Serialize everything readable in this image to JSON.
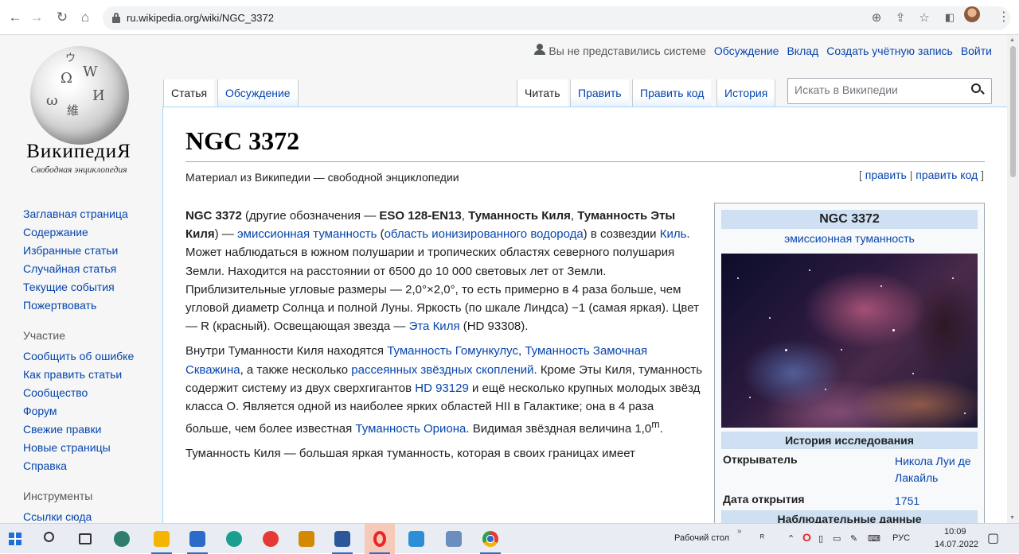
{
  "browser": {
    "url": "ru.wikipedia.org/wiki/NGC_3372",
    "icons": [
      "back-icon",
      "forward-icon",
      "reload-icon",
      "home-icon",
      "zoom-icon",
      "share-icon",
      "star-icon",
      "sidepanel-icon",
      "profile-icon",
      "menu-icon"
    ]
  },
  "logo": {
    "wordmark": "ВикипедиЯ",
    "tagline": "Свободная энциклопедия"
  },
  "sidebar": {
    "nav": [
      "Заглавная страница",
      "Содержание",
      "Избранные статьи",
      "Случайная статья",
      "Текущие события",
      "Пожертвовать"
    ],
    "participation_title": "Участие",
    "participation": [
      "Сообщить об ошибке",
      "Как править статьи",
      "Сообщество",
      "Форум",
      "Свежие правки",
      "Новые страницы",
      "Справка"
    ],
    "tools_title": "Инструменты",
    "tools": [
      "Ссылки сюда"
    ]
  },
  "personal": {
    "anon": "Вы не представились системе",
    "links": [
      "Обсуждение",
      "Вклад",
      "Создать учётную запись",
      "Войти"
    ]
  },
  "tabs": {
    "left": [
      "Статья",
      "Обсуждение"
    ],
    "right": [
      "Читать",
      "Править",
      "Править код",
      "История"
    ]
  },
  "search": {
    "placeholder": "Искать в Википедии"
  },
  "article": {
    "title": "NGC 3372",
    "tagline": "Материал из Википедии — свободной энциклопедии",
    "edit_open": "[ ",
    "edit": "править",
    "edit_sep": " | ",
    "edit_code": "править код",
    "edit_close": " ]",
    "p1": {
      "a": "NGC 3372",
      "b": " (другие обозначения — ",
      "c": "ESO 128-EN13",
      "d": ", ",
      "e": "Туманность Киля",
      "f": ", ",
      "g": "Туманность Эты Киля",
      "h": ") — ",
      "i": "эмиссионная туманность",
      "j": " (",
      "k": "область ионизированного водорода",
      "l": ") в созвездии ",
      "m": "Киль",
      "n": ". Может наблюдаться в южном полушарии и тропических областях северного полушария Земли. Находится на расстоянии от 6500 до 10 000 световых лет от Земли. Приблизительные угловые размеры — 2,0°×2,0°, то есть примерно в 4 раза больше, чем угловой диаметр Солнца и полной Луны. Яркость (по шкале Линдса) −1 (самая яркая). Цвет — R (красный). Освещающая звезда — ",
      "o": "Эта Киля",
      "p": " (HD 93308)."
    },
    "p2": {
      "a": "Внутри Туманности Киля находятся ",
      "b": "Туманность Гомункулус",
      "c": ", ",
      "d": "Туманность Замочная Скважина",
      "e": ", а также несколько ",
      "f": "рассеянных звёздных скоплений",
      "g": ". Кроме Эты Киля, туманность содержит систему из двух сверхгигантов ",
      "h": "HD 93129",
      "i": " и ещё несколько крупных молодых звёзд класса O. Является одной из наиболее ярких областей HII в Галактике; она в 4 раза больше, чем более известная ",
      "j": "Туманность Ориона",
      "k": ". Видимая звёздная величина 1,0",
      "l": "m",
      "m": "."
    },
    "p3": "Туманность Киля — большая яркая туманность, которая в своих границах имеет"
  },
  "infobox": {
    "title": "NGC 3372",
    "subtitle": "эмиссионная туманность",
    "section1": "История исследования",
    "rows": [
      {
        "key": "Открыватель",
        "value": "Никола Луи де Лакайль"
      },
      {
        "key": "Дата открытия",
        "value": "1751"
      }
    ],
    "section2": "Наблюдательные данные"
  },
  "taskbar": {
    "desktop_label": "Рабочий стол",
    "lang": "РУС",
    "time": "10:09",
    "date": "14.07.2022",
    "apps": [
      {
        "name": "windows-start-icon",
        "color": "#1e6fd9"
      },
      {
        "name": "search-icon",
        "color": "#333333"
      },
      {
        "name": "task-view-icon",
        "color": "#333333"
      },
      {
        "name": "app-circle-icon",
        "color": "#2e7d6e"
      },
      {
        "name": "file-explorer-icon",
        "color": "#f5b400"
      },
      {
        "name": "mail-icon",
        "color": "#2b6cc9"
      },
      {
        "name": "edge-icon",
        "color": "#1a9e8f"
      },
      {
        "name": "yandex-icon",
        "color": "#e53935"
      },
      {
        "name": "media-player-icon",
        "color": "#d48a00"
      },
      {
        "name": "word-icon",
        "color": "#2b579a"
      },
      {
        "name": "opera-icon",
        "color": "#e8262b"
      },
      {
        "name": "screen-icon",
        "color": "#2d8ed6"
      },
      {
        "name": "paint-icon",
        "color": "#6c8ebf"
      },
      {
        "name": "chrome-icon",
        "color": "#e53935"
      }
    ]
  }
}
